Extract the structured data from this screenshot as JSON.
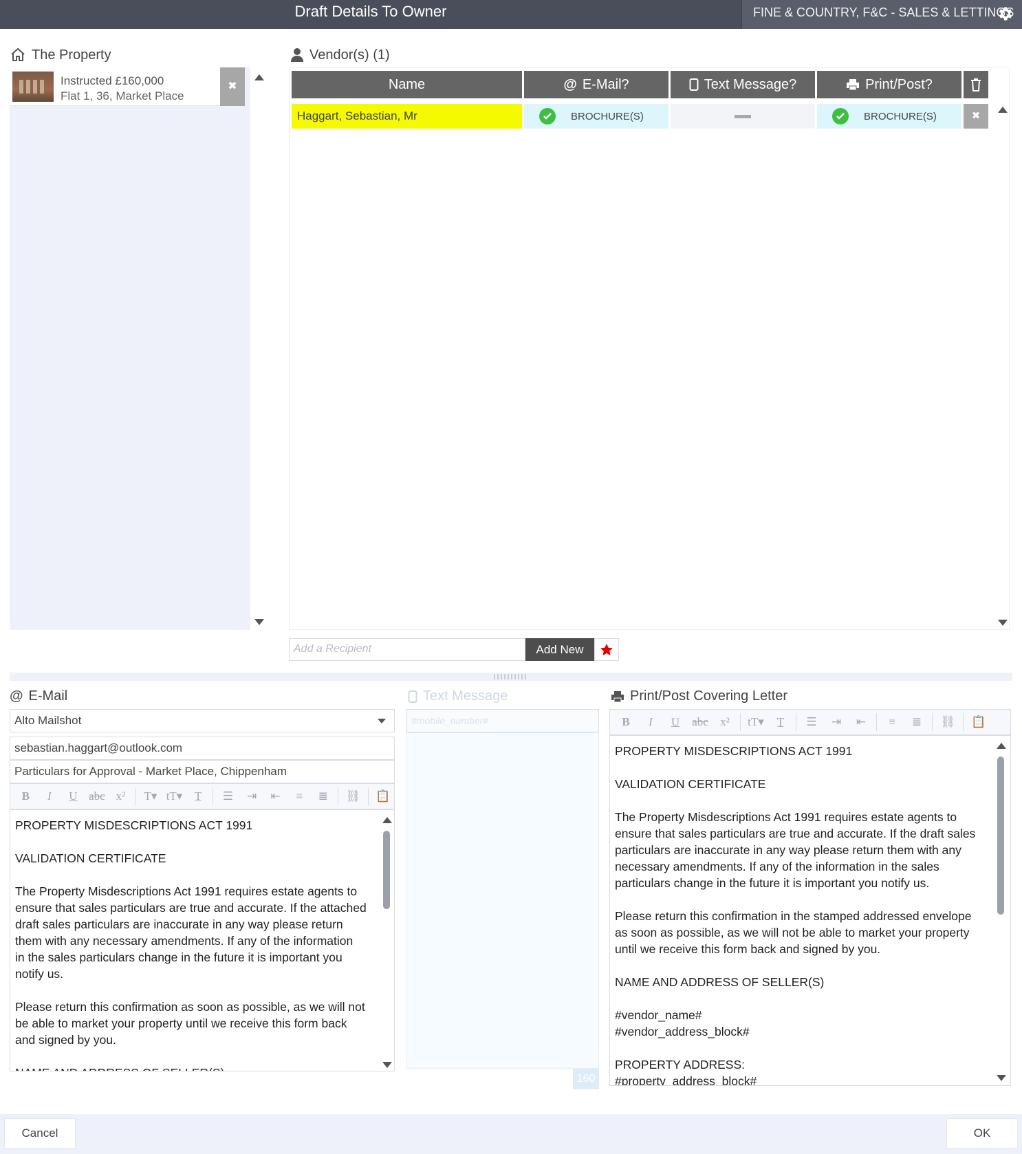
{
  "window": {
    "title": "Draft Details To Owner",
    "company": "FINE & COUNTRY, F&C - SALES & LETTINGS"
  },
  "property": {
    "heading": "The Property",
    "items": [
      {
        "line1": "Instructed £160,000",
        "line2": "Flat 1, 36, Market Place"
      }
    ]
  },
  "vendors": {
    "heading": "Vendor(s) (1)",
    "columns": {
      "name": "Name",
      "email": "E-Mail?",
      "text": "Text Message?",
      "print": "Print/Post?"
    },
    "rows": [
      {
        "name": "Haggart, Sebastian, Mr",
        "email": "BROCHURE(S)",
        "text": "—",
        "print": "BROCHURE(S)"
      }
    ],
    "add_placeholder": "Add a Recipient",
    "add_button": "Add New",
    "colors": {
      "name_highlight": "#f5fa00",
      "channel_active": "#dcf6fb"
    }
  },
  "email": {
    "heading": "E-Mail",
    "template": "Alto Mailshot",
    "to": "sebastian.haggart@outlook.com",
    "subject": "Particulars for Approval - Market Place, Chippenham",
    "body": "PROPERTY MISDESCRIPTIONS ACT 1991\n\nVALIDATION CERTIFICATE\n\nThe Property Misdescriptions Act 1991 requires estate agents to\nensure that sales particulars are true and accurate. If the attached\ndraft sales particulars are inaccurate in any way please return\nthem with any necessary amendments. If any of the information\nin the sales particulars change in the future it is important you\nnotify us.\n\nPlease return this confirmation as soon as possible, as we will not\nbe able to market your property until we receive this form back\nand signed by you.\n\nNAME AND ADDRESS OF SELLER(S)"
  },
  "text_message": {
    "heading": "Text Message",
    "mobile_placeholder": "#mobile_number#",
    "counter": "160"
  },
  "letter": {
    "heading": "Print/Post Covering Letter",
    "body": "PROPERTY MISDESCRIPTIONS ACT 1991\n\nVALIDATION CERTIFICATE\n\nThe Property Misdescriptions Act 1991 requires estate agents to\nensure that sales particulars are true and accurate. If the draft sales\nparticulars are inaccurate in any way please return them with any\nnecessary amendments. If any of the information in the sales\nparticulars change in the future it is important you notify us.\n\nPlease return this confirmation in the stamped addressed envelope\nas soon as possible, as we will not be able to market your property\nuntil we receive this form back and signed by you.\n\nNAME AND ADDRESS OF SELLER(S)\n\n#vendor_name#\n#vendor_address_block#\n\nPROPERTY ADDRESS:\n#property_address_block#"
  },
  "footer": {
    "cancel": "Cancel",
    "ok": "OK"
  },
  "icons": {
    "gear": "gear-icon",
    "home": "home-icon",
    "user": "user-icon",
    "at": "at-icon",
    "mobile": "mobile-icon",
    "printer": "printer-icon",
    "trash": "trash-icon",
    "check": "check-circle-icon",
    "close": "close-icon",
    "star": "star-icon"
  }
}
